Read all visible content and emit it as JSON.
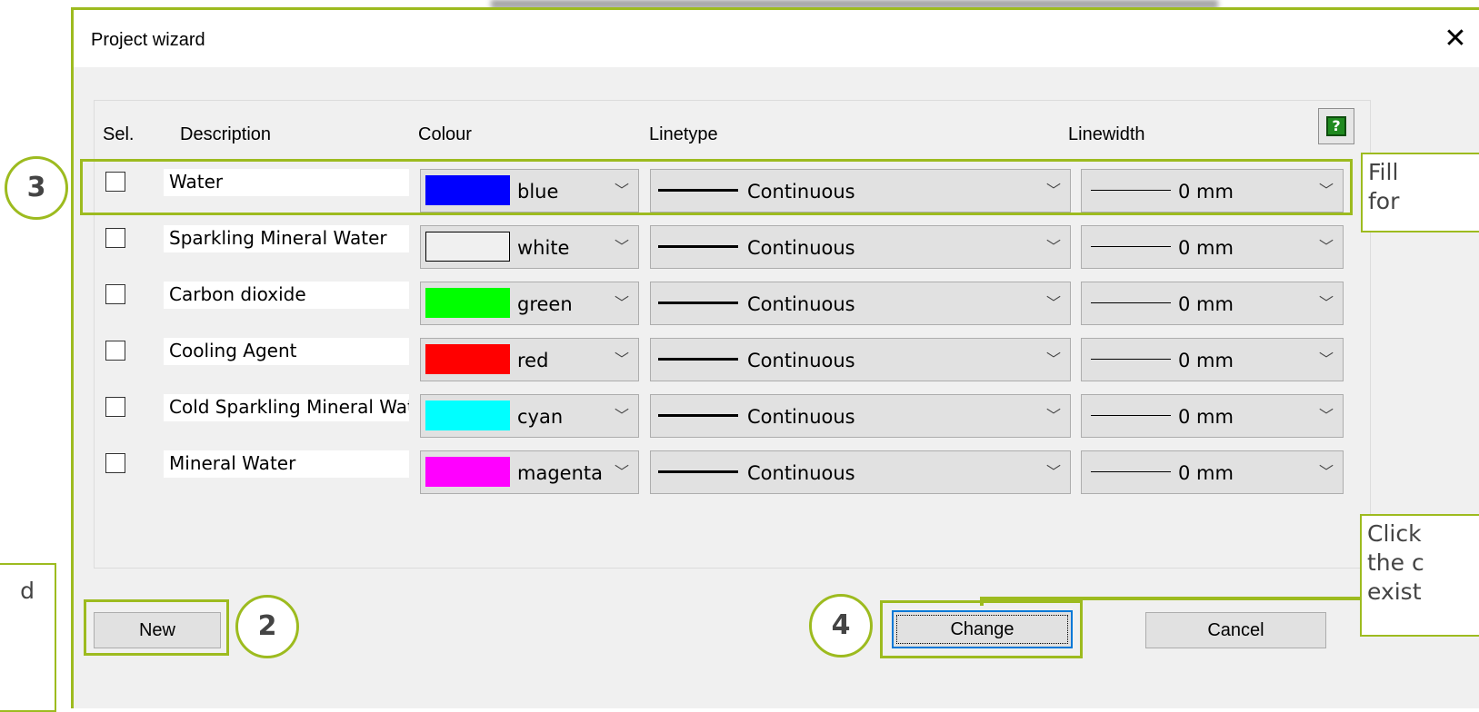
{
  "window": {
    "title": "Project wizard",
    "close_glyph": "✕"
  },
  "headers": {
    "sel": "Sel.",
    "description": "Description",
    "colour": "Colour",
    "linetype": "Linetype",
    "linewidth": "Linewidth"
  },
  "help_button": {
    "icon": "help-icon",
    "glyph": "?"
  },
  "rows": [
    {
      "description": "Water",
      "colour_name": "blue",
      "colour_hex": "#0000ff",
      "linetype": "Continuous",
      "linewidth": "0 mm",
      "selected": false
    },
    {
      "description": "Sparkling Mineral Water",
      "colour_name": "white",
      "colour_hex": "#f0f0f0",
      "linetype": "Continuous",
      "linewidth": "0 mm",
      "selected": false
    },
    {
      "description": "Carbon dioxide",
      "colour_name": "green",
      "colour_hex": "#00ff00",
      "linetype": "Continuous",
      "linewidth": "0 mm",
      "selected": false
    },
    {
      "description": "Cooling Agent",
      "colour_name": "red",
      "colour_hex": "#ff0000",
      "linetype": "Continuous",
      "linewidth": "0 mm",
      "selected": false
    },
    {
      "description": "Cold Sparkling Mineral Water",
      "colour_name": "cyan",
      "colour_hex": "#00ffff",
      "linetype": "Continuous",
      "linewidth": "0 mm",
      "selected": false
    },
    {
      "description": "Mineral Water",
      "colour_name": "magenta",
      "colour_hex": "#ff00ff",
      "linetype": "Continuous",
      "linewidth": "0 mm",
      "selected": false
    }
  ],
  "buttons": {
    "new": "New",
    "change": "Change",
    "cancel": "Cancel"
  },
  "annotations": {
    "badge_2": "2",
    "badge_3": "3",
    "badge_4": "4",
    "callout_fill": "Fill\nfor",
    "callout_click": "Click\nthe c\nexist",
    "callout_left": "d"
  },
  "colors": {
    "accent": "#9dbb1f",
    "default_button_border": "#0078d7"
  }
}
